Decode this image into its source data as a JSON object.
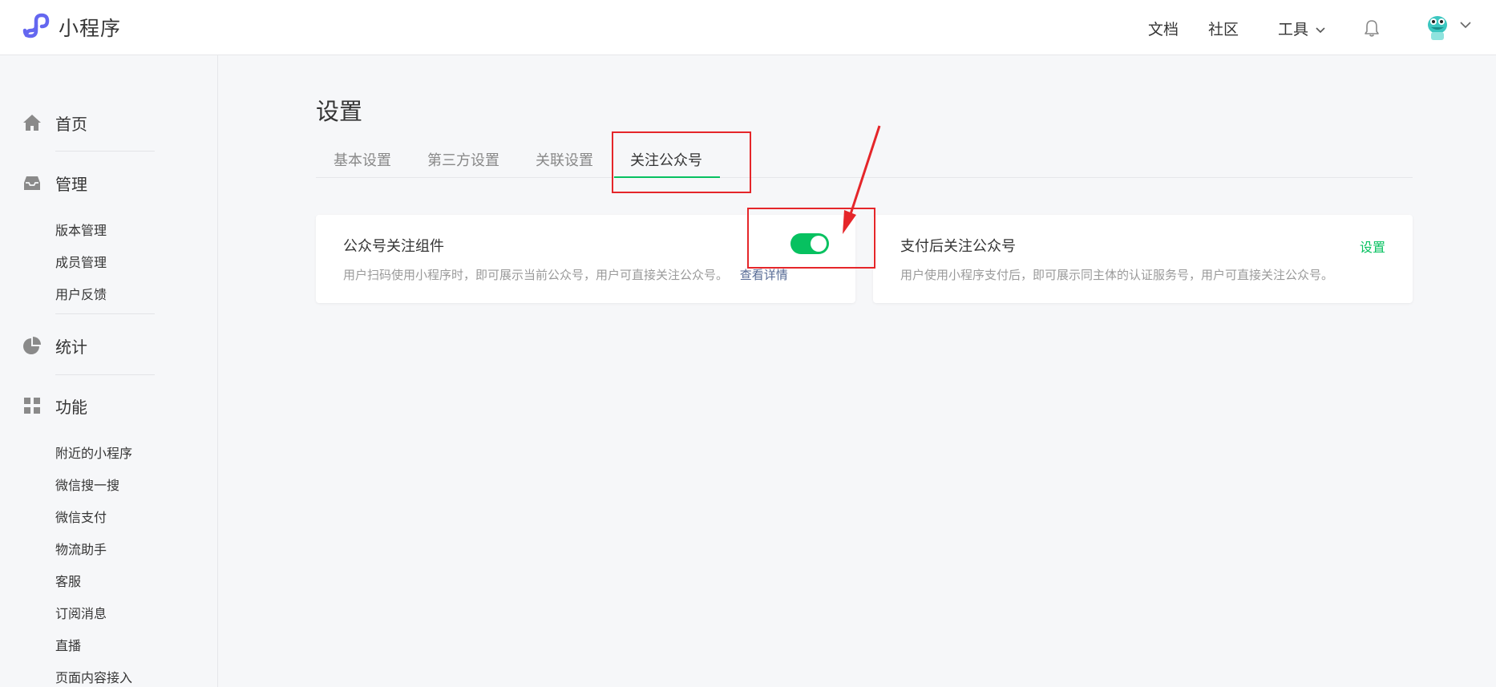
{
  "header": {
    "app_name": "小程序",
    "nav": {
      "docs": "文档",
      "community": "社区",
      "tools": "工具"
    }
  },
  "sidebar": {
    "sections": [
      {
        "label": "首页",
        "icon": "home-icon",
        "items": []
      },
      {
        "label": "管理",
        "icon": "inbox-icon",
        "items": [
          "版本管理",
          "成员管理",
          "用户反馈"
        ]
      },
      {
        "label": "统计",
        "icon": "pie-chart-icon",
        "items": []
      },
      {
        "label": "功能",
        "icon": "grid-icon",
        "items": [
          "附近的小程序",
          "微信搜一搜",
          "微信支付",
          "物流助手",
          "客服",
          "订阅消息",
          "直播",
          "页面内容接入"
        ]
      }
    ]
  },
  "main": {
    "title": "设置",
    "tabs": [
      "基本设置",
      "第三方设置",
      "关联设置",
      "关注公众号"
    ],
    "active_tab": "关注公众号",
    "cards": [
      {
        "title": "公众号关注组件",
        "description": "用户扫码使用小程序时，即可展示当前公众号，用户可直接关注公众号。",
        "link": "查看详情",
        "switch_on": true
      },
      {
        "title": "支付后关注公众号",
        "description": "用户使用小程序支付后，即可展示同主体的认证服务号，用户可直接关注公众号。",
        "action": "设置"
      }
    ]
  },
  "colors": {
    "accent": "#07c160",
    "link": "#576b95",
    "annotation": "#e5262a"
  }
}
